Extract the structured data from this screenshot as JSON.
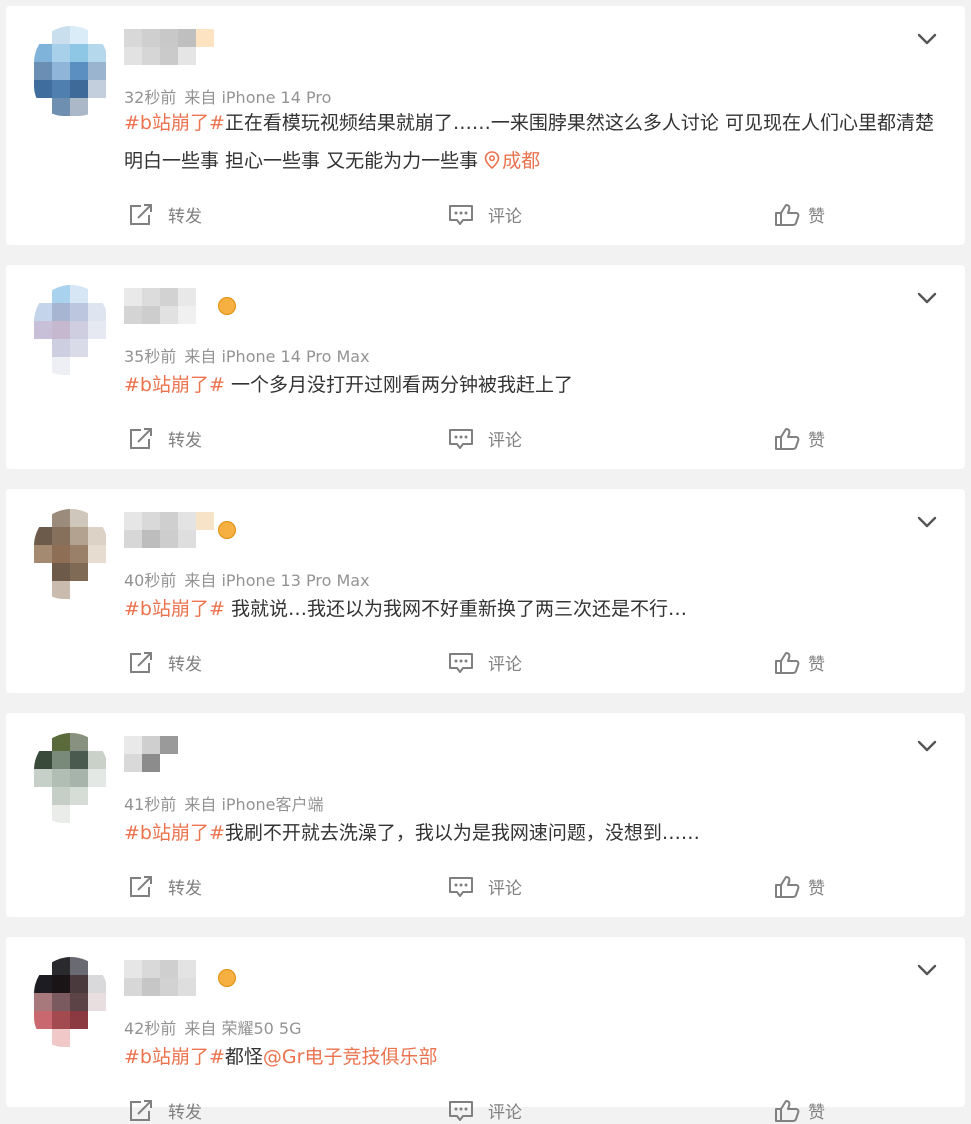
{
  "actions": {
    "repost_label": "转发",
    "comment_label": "评论",
    "like_label": "赞"
  },
  "posts": [
    {
      "time": "32秒前",
      "source": "来自 iPhone 14 Pro",
      "topic": "#b站崩了#",
      "text": "正在看模玩视频结果就崩了……一来围脖果然这么多人讨论 可见现在人们心里都清楚明白一些事 担心一些事 又无能为力一些事",
      "location": "成都",
      "mention": "",
      "avatar_colors": [
        "#ffffff",
        "#c9dfee",
        "#d9ecf7",
        "#ffffff",
        "#7fb3d9",
        "#a9d0ea",
        "#8ec6e6",
        "#b6d8ec",
        "#6b8eb4",
        "#8fb6d8",
        "#5b8fc2",
        "#9ab3cf",
        "#3f6e9e",
        "#4f7fae",
        "#3e6a99",
        "#c3cfdc",
        "#ffffff",
        "#6f8fb0",
        "#aab8c7",
        "#ffffff"
      ],
      "name_colors": [
        "#d8d8d8",
        "#cfcfcf",
        "#c8c8c8",
        "#bfbfbf",
        "#fde3c2",
        "#e2e2e2",
        "#d6d6d6",
        "#cacaca",
        "#e5e5e5",
        "#ffffff"
      ],
      "badge": false
    },
    {
      "time": "35秒前",
      "source": "来自 iPhone 14 Pro Max",
      "topic": "#b站崩了#",
      "text": " 一个多月没打开过刚看两分钟被我赶上了",
      "location": "",
      "mention": "",
      "avatar_colors": [
        "#ffffff",
        "#a9d2ee",
        "#d6e6f5",
        "#ffffff",
        "#c4d4ea",
        "#a7b4d2",
        "#bcc7df",
        "#dfe5f0",
        "#c7c0d8",
        "#c6b9cf",
        "#cfcde0",
        "#e6e9f2",
        "#ffffff",
        "#cdcfe0",
        "#d9dbe8",
        "#ffffff",
        "#ffffff",
        "#eeeff4",
        "#ffffff",
        "#ffffff"
      ],
      "name_colors": [
        "#e9e9e9",
        "#dcdcdc",
        "#d2d2d2",
        "#e8e8e8",
        "#ffffff",
        "#d4d4d4",
        "#cdcdcd",
        "#e1e1e1",
        "#f0f0f0",
        "#ffffff"
      ],
      "badge": true
    },
    {
      "time": "40秒前",
      "source": "来自 iPhone 13 Pro Max",
      "topic": "#b站崩了#",
      "text": " 我就说…我还以为我网不好重新换了两三次还是不行…",
      "location": "",
      "mention": "",
      "avatar_colors": [
        "#ffffff",
        "#9b8b7a",
        "#cfc6bc",
        "#ffffff",
        "#6c5a4a",
        "#86705c",
        "#b3a290",
        "#dcd2c6",
        "#a48a70",
        "#8e6e54",
        "#9a8068",
        "#e6dccf",
        "#ffffff",
        "#6e5a48",
        "#7f6a56",
        "#ffffff",
        "#ffffff",
        "#c9bcae",
        "#ffffff",
        "#ffffff"
      ],
      "name_colors": [
        "#e6e6e6",
        "#d9d9d9",
        "#cfcfcf",
        "#e3e3e3",
        "#f6e3c8",
        "#d7d7d7",
        "#bdbdbd",
        "#cdcdcd",
        "#dedede",
        "#ffffff"
      ],
      "badge": true
    },
    {
      "time": "41秒前",
      "source": "来自 iPhone客户端",
      "topic": "#b站崩了#",
      "text": "我刷不开就去洗澡了，我以为是我网速问题，没想到……",
      "location": "",
      "mention": "",
      "avatar_colors": [
        "#ffffff",
        "#5a6a3a",
        "#889080",
        "#ffffff",
        "#3a4a3a",
        "#7a8a7a",
        "#4a5a4e",
        "#c9d1c9",
        "#c6d0c8",
        "#b0beb4",
        "#a6b4ac",
        "#e4e8e4",
        "#ffffff",
        "#c6cec8",
        "#d6dcd6",
        "#ffffff",
        "#ffffff",
        "#e9ece9",
        "#ffffff",
        "#ffffff"
      ],
      "name_colors": [
        "#e9e9e9",
        "#cfcfcf",
        "#9a9a9a",
        "#ffffff",
        "#ffffff",
        "#d9d9d9",
        "#8c8c8c",
        "#ffffff",
        "#ffffff",
        "#ffffff"
      ],
      "badge": false
    },
    {
      "time": "42秒前",
      "source": "来自 荣耀50 5G",
      "topic": "#b站崩了#",
      "text": "都怪",
      "location": "",
      "mention": "@Gr电子竞技俱乐部",
      "avatar_colors": [
        "#ffffff",
        "#2a2a2e",
        "#6a6a72",
        "#ffffff",
        "#1c1c22",
        "#1a1416",
        "#4a3a3e",
        "#d9d9dc",
        "#a7787c",
        "#7a5a5e",
        "#5c4446",
        "#e8dedf",
        "#c9686e",
        "#a24a50",
        "#8a3a40",
        "#ffffff",
        "#ffffff",
        "#f0c8c8",
        "#ffffff",
        "#ffffff"
      ],
      "name_colors": [
        "#e6e6e6",
        "#d9d9d9",
        "#cfcfcf",
        "#e3e3e3",
        "#ffffff",
        "#d7d7d7",
        "#c6c6c6",
        "#d2d2d2",
        "#dedede",
        "#ffffff"
      ],
      "badge": true
    }
  ]
}
